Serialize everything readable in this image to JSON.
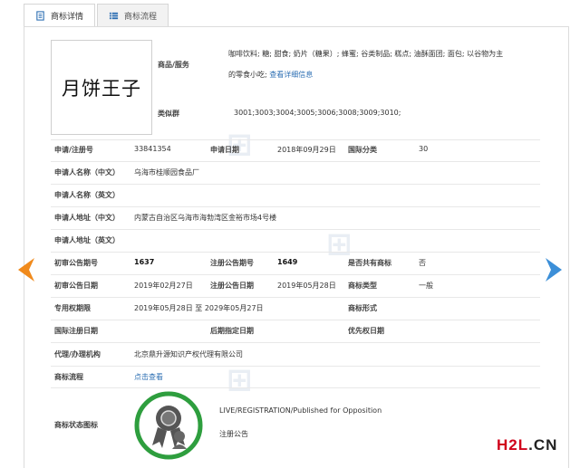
{
  "tabs": [
    {
      "label": "商标详情",
      "icon": "document-icon",
      "active": true
    },
    {
      "label": "商标流程",
      "icon": "list-icon",
      "active": false
    }
  ],
  "mark_image_text": "月饼王子",
  "goods": {
    "label": "商品/服务",
    "text_line1": "咖啡饮料; 糖; 甜食; 奶片（糖果）; 蜂蜜; 谷类制品; 糕点; 油酥面团; 面包; 以谷物为主",
    "text_line2": "的零食小吃;",
    "more_link": "查看详细信息"
  },
  "similar_group": {
    "label": "类似群",
    "value": "3001;3003;3004;3005;3006;3008;3009;3010;"
  },
  "fields": {
    "reg_no": {
      "label": "申请/注册号",
      "value": "33841354"
    },
    "apply_date": {
      "label": "申请日期",
      "value": "2018年09月29日"
    },
    "intl_class": {
      "label": "国际分类",
      "value": "30"
    },
    "applicant_cn": {
      "label": "申请人名称（中文）",
      "value": "乌海市桂顺园食品厂"
    },
    "applicant_en": {
      "label": "申请人名称（英文）",
      "value": ""
    },
    "address_cn": {
      "label": "申请人地址（中文）",
      "value": "内蒙古自治区乌海市海勃湾区金裕市场4号楼"
    },
    "address_en": {
      "label": "申请人地址（英文）",
      "value": ""
    },
    "prelim_no": {
      "label": "初审公告期号",
      "value": "1637"
    },
    "reg_pub_no": {
      "label": "注册公告期号",
      "value": "1649"
    },
    "shared": {
      "label": "是否共有商标",
      "value": "否"
    },
    "prelim_date": {
      "label": "初审公告日期",
      "value": "2019年02月27日"
    },
    "reg_pub_date": {
      "label": "注册公告日期",
      "value": "2019年05月28日"
    },
    "mark_type": {
      "label": "商标类型",
      "value": "一般"
    },
    "exclusive": {
      "label": "专用权期限",
      "from": "2019年05月28日",
      "to_word": "至",
      "to": "2029年05月27日"
    },
    "mark_form": {
      "label": "商标形式",
      "value": ""
    },
    "intl_reg_date": {
      "label": "国际注册日期",
      "value": ""
    },
    "later_date": {
      "label": "后期指定日期",
      "value": ""
    },
    "priority_date": {
      "label": "优先权日期",
      "value": ""
    },
    "agent": {
      "label": "代理/办理机构",
      "value": "北京鼎升源知识产权代理有限公司"
    },
    "process": {
      "label": "商标流程",
      "value": "点击查看"
    },
    "status_icon": {
      "label": "商标状态图标",
      "status_en": "LIVE/REGISTRATION/Published for Opposition",
      "status_cn": "注册公告",
      "badge_color": "#2e9e3e"
    }
  },
  "watermark": {
    "text1": "H2L",
    "text2": ".CN"
  },
  "colors": {
    "accent": "#2d6fb3",
    "arrow_left": "#f08a1c",
    "arrow_right": "#3c8fd8",
    "watermark_red": "#d0021b"
  }
}
